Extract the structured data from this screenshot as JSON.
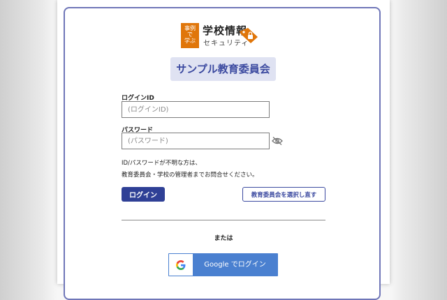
{
  "logo": {
    "badge_line1": "事例",
    "badge_line2": "で",
    "badge_line3": "学ぶ",
    "title": "学校情報",
    "subtitle": "セキュリティ",
    "brand_color": "#e0760a"
  },
  "page_title": "サンプル教育委員会",
  "login_id": {
    "label": "ログインID",
    "placeholder": "(ログインID)",
    "value": ""
  },
  "password": {
    "label": "パスワード",
    "placeholder": "(パスワード)",
    "value": "",
    "toggle_icon": "eye-slash-icon"
  },
  "help_note": {
    "line1": "ID/パスワードが不明な方は、",
    "line2": "教育委員会・学校の管理者までお問合せください。"
  },
  "buttons": {
    "login": "ログイン",
    "reselect": "教育委員会を選択し直す",
    "google": "Google でログイン"
  },
  "or_text": "または",
  "colors": {
    "accent": "#2f4096",
    "frame": "#6f76b8",
    "title_bg": "#dfe2f2",
    "google_blue": "#4a80d0"
  }
}
